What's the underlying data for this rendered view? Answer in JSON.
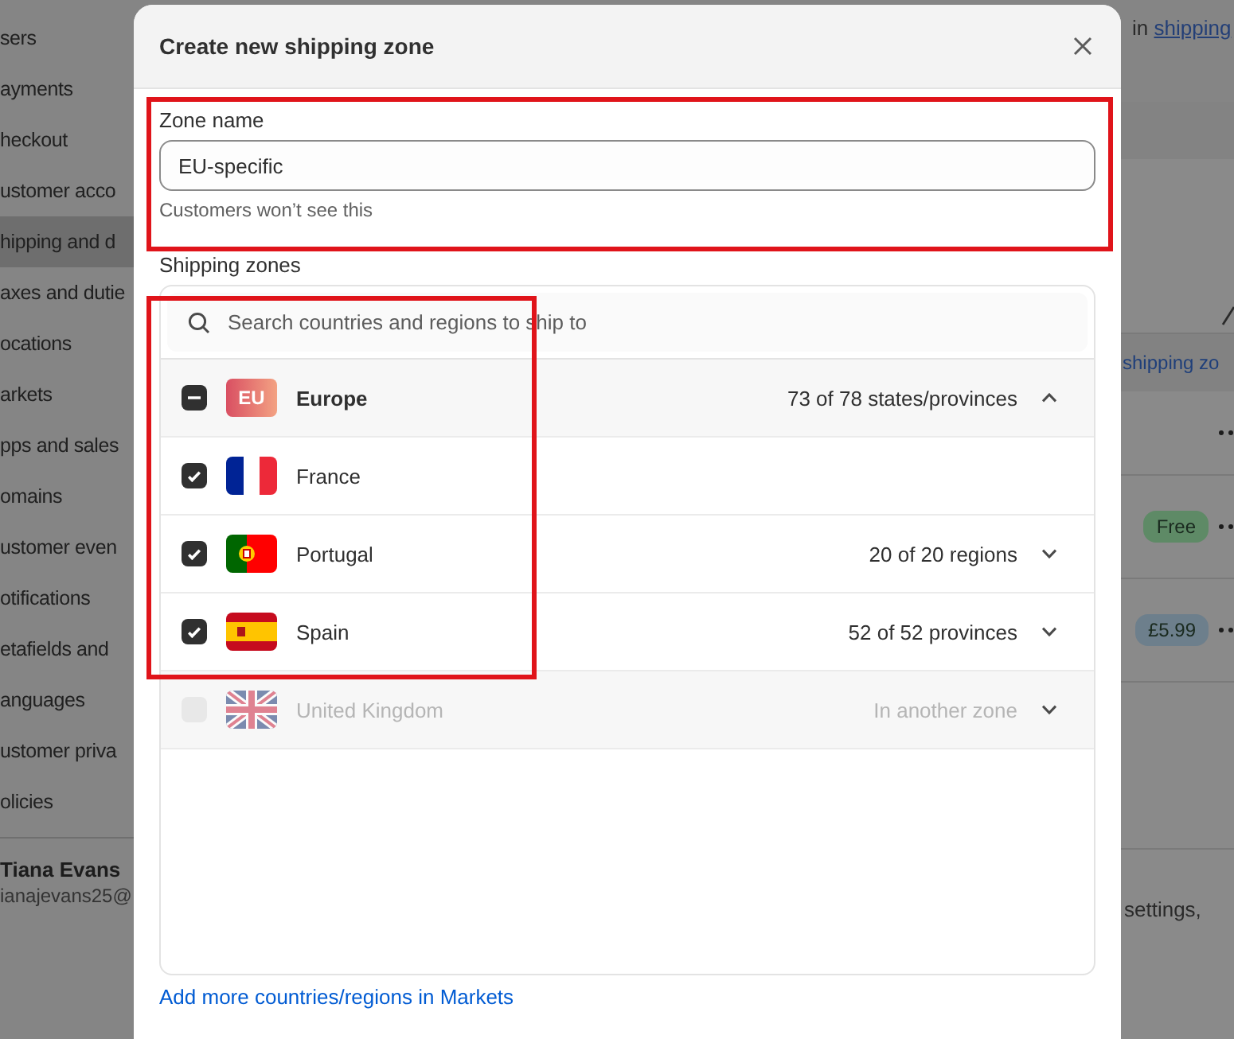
{
  "sidebar": {
    "items": [
      {
        "label": "sers",
        "selected": false
      },
      {
        "label": "ayments",
        "selected": false
      },
      {
        "label": "heckout",
        "selected": false
      },
      {
        "label": "ustomer acco",
        "selected": false
      },
      {
        "label": "hipping and d",
        "selected": true
      },
      {
        "label": "axes and dutie",
        "selected": false
      },
      {
        "label": "ocations",
        "selected": false
      },
      {
        "label": "arkets",
        "selected": false
      },
      {
        "label": "pps and sales",
        "selected": false
      },
      {
        "label": "omains",
        "selected": false
      },
      {
        "label": "ustomer even",
        "selected": false
      },
      {
        "label": "otifications",
        "selected": false
      },
      {
        "label": "etafields and",
        "selected": false
      },
      {
        "label": "anguages",
        "selected": false
      },
      {
        "label": "ustomer priva",
        "selected": false
      },
      {
        "label": "olicies",
        "selected": false
      }
    ],
    "user": {
      "name": "Tiana Evans",
      "email": "ianajevans25@"
    }
  },
  "background": {
    "header_text": "in",
    "header_link": "shipping",
    "zones_link": "shipping zo",
    "rates": [
      {
        "badge": "Free",
        "color": "#5e8a66"
      },
      {
        "badge": "£5.99",
        "color": "#6d7f8c"
      }
    ],
    "footer_text": "settings,"
  },
  "modal": {
    "title": "Create new shipping zone",
    "zone_name": {
      "label": "Zone name",
      "value": "EU-specific",
      "help": "Customers won’t see this",
      "highlighted": true
    },
    "shipping_zones": {
      "label": "Shipping zones",
      "search_placeholder": "Search countries and regions to ship to",
      "highlighted": true,
      "rows": [
        {
          "name": "Europe",
          "badge": "EU",
          "kind": "group",
          "indeterminate": true,
          "disabled": false,
          "expanded": true,
          "count": "73 of 78 states/provinces"
        },
        {
          "name": "France",
          "kind": "fr",
          "checked": true,
          "disabled": false
        },
        {
          "name": "Portugal",
          "kind": "pt",
          "checked": true,
          "disabled": false,
          "expanded": false,
          "count": "20 of 20 regions"
        },
        {
          "name": "Spain",
          "kind": "es",
          "checked": true,
          "disabled": false,
          "expanded": false,
          "count": "52 of 52 provinces"
        },
        {
          "name": "United Kingdom",
          "kind": "gb",
          "checked": false,
          "disabled": true,
          "expanded": false,
          "count": "In another zone"
        }
      ]
    },
    "footer_link": "Add more countries/regions in Markets"
  }
}
